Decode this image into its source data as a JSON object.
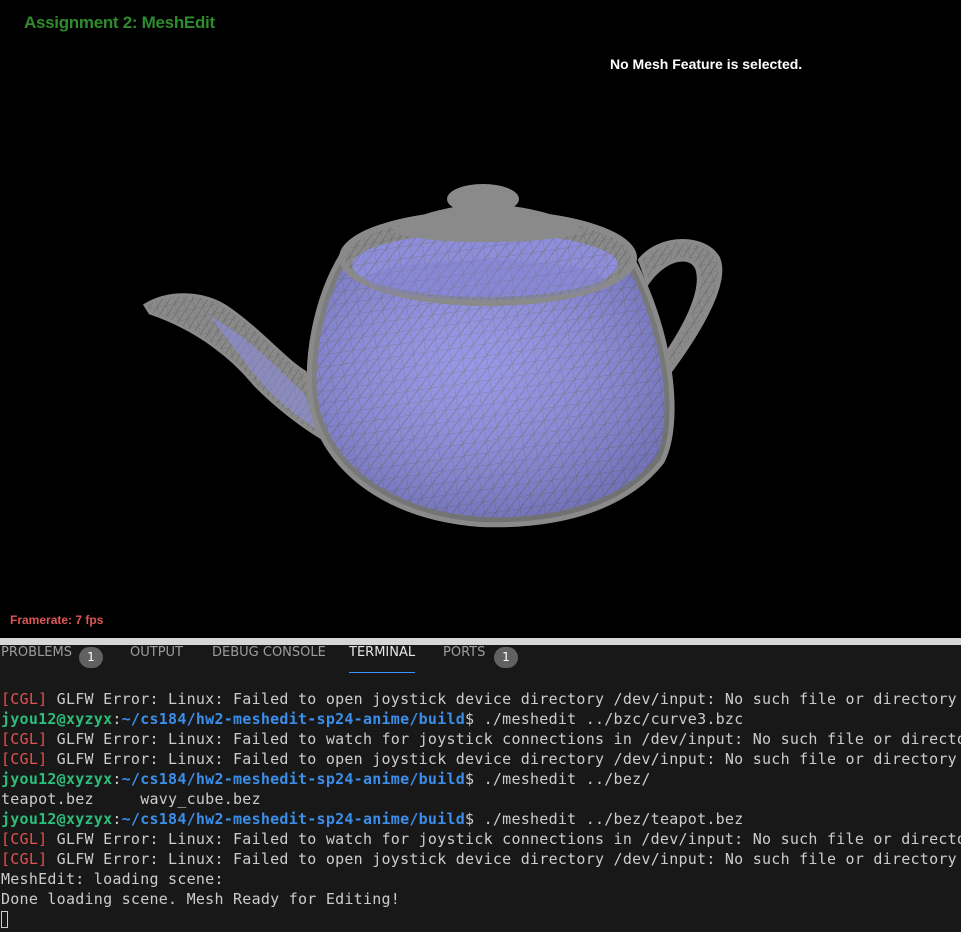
{
  "app": {
    "title": "Assignment 2: MeshEdit",
    "status": "No Mesh Feature is selected.",
    "framerate": "Framerate: 7 fps"
  },
  "colors": {
    "title": "#2e8b2e",
    "framerate": "#e05555",
    "mesh_face": "#8e8ee6",
    "mesh_wire": "#8a8a8a",
    "cgl_tag": "#e0534f",
    "prompt_user": "#2ebc7a",
    "prompt_path": "#3b8eea",
    "tab_active_underline": "#3794ff"
  },
  "panel": {
    "tabs": [
      {
        "label": "PROBLEMS",
        "badge": "1",
        "active": false
      },
      {
        "label": "OUTPUT",
        "active": false
      },
      {
        "label": "DEBUG CONSOLE",
        "active": false
      },
      {
        "label": "TERMINAL",
        "active": true
      },
      {
        "label": "PORTS",
        "badge": "1",
        "active": false
      }
    ]
  },
  "terminal": {
    "lines": [
      {
        "type": "cgl",
        "tag": "[CGL]",
        "text": " GLFW Error: Linux: Failed to open joystick device directory /dev/input: No such file or directory"
      },
      {
        "type": "prompt",
        "user": "jyou12@xyzyx",
        "sep": ":",
        "path": "~/cs184/hw2-meshedit-sp24-anime/build",
        "cmd": "$ ./meshedit ../bzc/curve3.bzc"
      },
      {
        "type": "cgl",
        "tag": "[CGL]",
        "text": " GLFW Error: Linux: Failed to watch for joystick connections in /dev/input: No such file or directory"
      },
      {
        "type": "cgl",
        "tag": "[CGL]",
        "text": " GLFW Error: Linux: Failed to open joystick device directory /dev/input: No such file or directory"
      },
      {
        "type": "prompt",
        "user": "jyou12@xyzyx",
        "sep": ":",
        "path": "~/cs184/hw2-meshedit-sp24-anime/build",
        "cmd": "$ ./meshedit ../bez/"
      },
      {
        "type": "plain",
        "text": "teapot.bez     wavy_cube.bez"
      },
      {
        "type": "prompt",
        "user": "jyou12@xyzyx",
        "sep": ":",
        "path": "~/cs184/hw2-meshedit-sp24-anime/build",
        "cmd": "$ ./meshedit ../bez/teapot.bez"
      },
      {
        "type": "cgl",
        "tag": "[CGL]",
        "text": " GLFW Error: Linux: Failed to watch for joystick connections in /dev/input: No such file or directory"
      },
      {
        "type": "cgl",
        "tag": "[CGL]",
        "text": " GLFW Error: Linux: Failed to open joystick device directory /dev/input: No such file or directory"
      },
      {
        "type": "plain",
        "text": "MeshEdit: loading scene:"
      },
      {
        "type": "plain",
        "text": "Done loading scene. Mesh Ready for Editing!"
      }
    ]
  }
}
